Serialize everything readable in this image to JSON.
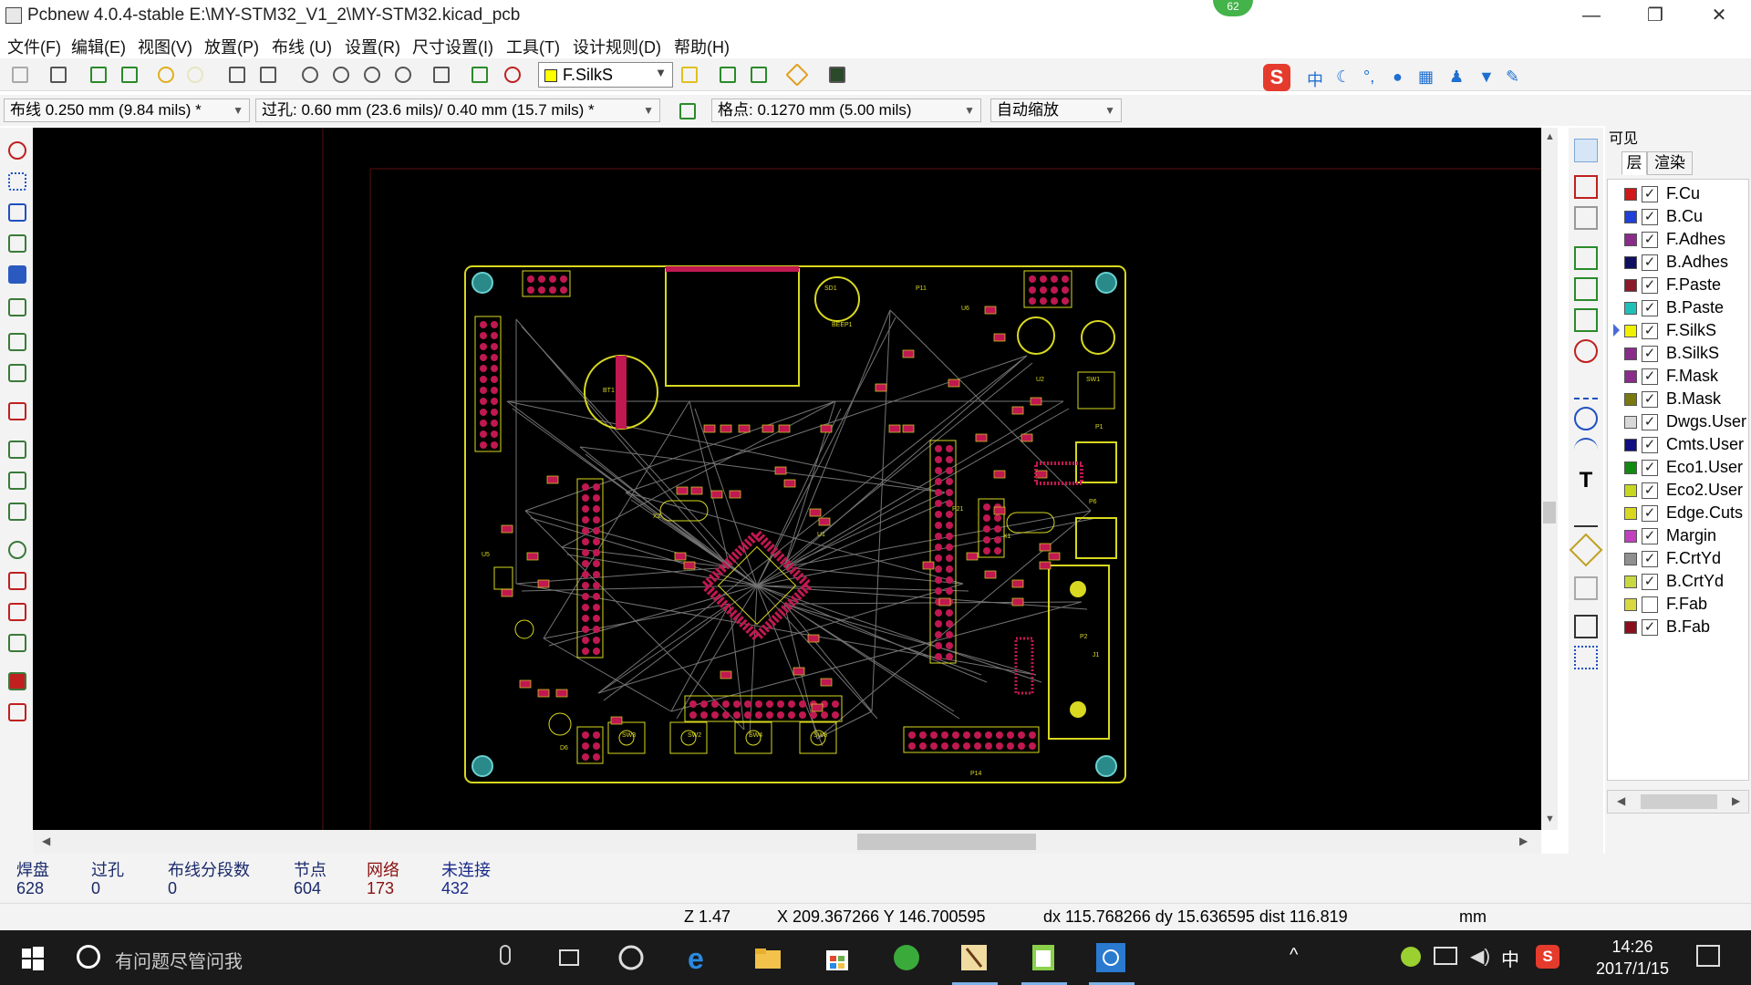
{
  "window": {
    "title": "Pcbnew 4.0.4-stable E:\\MY-STM32_V1_2\\MY-STM32.kicad_pcb",
    "notification_count": "62",
    "minimize": "—",
    "restore": "❐",
    "close": "✕"
  },
  "menu": [
    "文件(F)",
    "编辑(E)",
    "视图(V)",
    "放置(P)",
    "布线 (U)",
    "设置(R)",
    "尺寸设置(I)",
    "工具(T)",
    "设计规则(D)",
    "帮助(H)"
  ],
  "toolbar": {
    "active_layer": "F.SilkS",
    "active_layer_color": "#ffff00"
  },
  "options": {
    "track_width": "布线 0.250 mm (9.84 mils) *",
    "via_size": "过孔: 0.60 mm (23.6 mils)/ 0.40 mm (15.7 mils) *",
    "grid": "格点: 0.1270 mm (5.00 mils)",
    "zoom": "自动缩放"
  },
  "layer_panel": {
    "title": "可见",
    "tabs": [
      "层",
      "渲染"
    ],
    "layers": [
      {
        "name": "F.Cu",
        "color": "#d01818",
        "checked": true
      },
      {
        "name": "B.Cu",
        "color": "#2040d8",
        "checked": true
      },
      {
        "name": "F.Adhes",
        "color": "#8a2c8a",
        "checked": true
      },
      {
        "name": "B.Adhes",
        "color": "#101060",
        "checked": true
      },
      {
        "name": "F.Paste",
        "color": "#8a1a2a",
        "checked": true
      },
      {
        "name": "B.Paste",
        "color": "#20c0b8",
        "checked": true
      },
      {
        "name": "F.SilkS",
        "color": "#f0f000",
        "checked": true,
        "active": true
      },
      {
        "name": "B.SilkS",
        "color": "#8a2c8a",
        "checked": true
      },
      {
        "name": "F.Mask",
        "color": "#8a2c8a",
        "checked": true
      },
      {
        "name": "B.Mask",
        "color": "#7a7a10",
        "checked": true
      },
      {
        "name": "Dwgs.User",
        "color": "#d8d8d8",
        "checked": true
      },
      {
        "name": "Cmts.User",
        "color": "#101080",
        "checked": true
      },
      {
        "name": "Eco1.User",
        "color": "#108a10",
        "checked": true
      },
      {
        "name": "Eco2.User",
        "color": "#c8d820",
        "checked": true
      },
      {
        "name": "Edge.Cuts",
        "color": "#d8d820",
        "checked": true
      },
      {
        "name": "Margin",
        "color": "#c040c0",
        "checked": true
      },
      {
        "name": "F.CrtYd",
        "color": "#909090",
        "checked": true
      },
      {
        "name": "B.CrtYd",
        "color": "#c8d840",
        "checked": true
      },
      {
        "name": "F.Fab",
        "color": "#d8d840",
        "checked": false
      },
      {
        "name": "B.Fab",
        "color": "#8a1020",
        "checked": true
      }
    ]
  },
  "board_info": {
    "labels": [
      "焊盘",
      "过孔",
      "布线分段数",
      "节点",
      "网络",
      "未连接"
    ],
    "values": [
      "628",
      "0",
      "0",
      "604",
      "173",
      "432"
    ]
  },
  "status": {
    "zoom": "Z 1.47",
    "xy": "X 209.367266  Y 146.700595",
    "delta": "dx 115.768266  dy 15.636595  dist 116.819",
    "units": "mm"
  },
  "taskbar": {
    "search_placeholder": "有问题尽管问我",
    "ime": "中",
    "time": "14:26",
    "date": "2017/1/15"
  },
  "pcb_labels": [
    "SD1",
    "BT1",
    "P11",
    "P1",
    "P2",
    "P14",
    "P21",
    "SW1",
    "SW2",
    "SW3",
    "SW4",
    "SW5",
    "U1",
    "U2",
    "U5",
    "U6",
    "X1",
    "X2",
    "D6",
    "J1",
    "P6",
    "BEEP1"
  ]
}
